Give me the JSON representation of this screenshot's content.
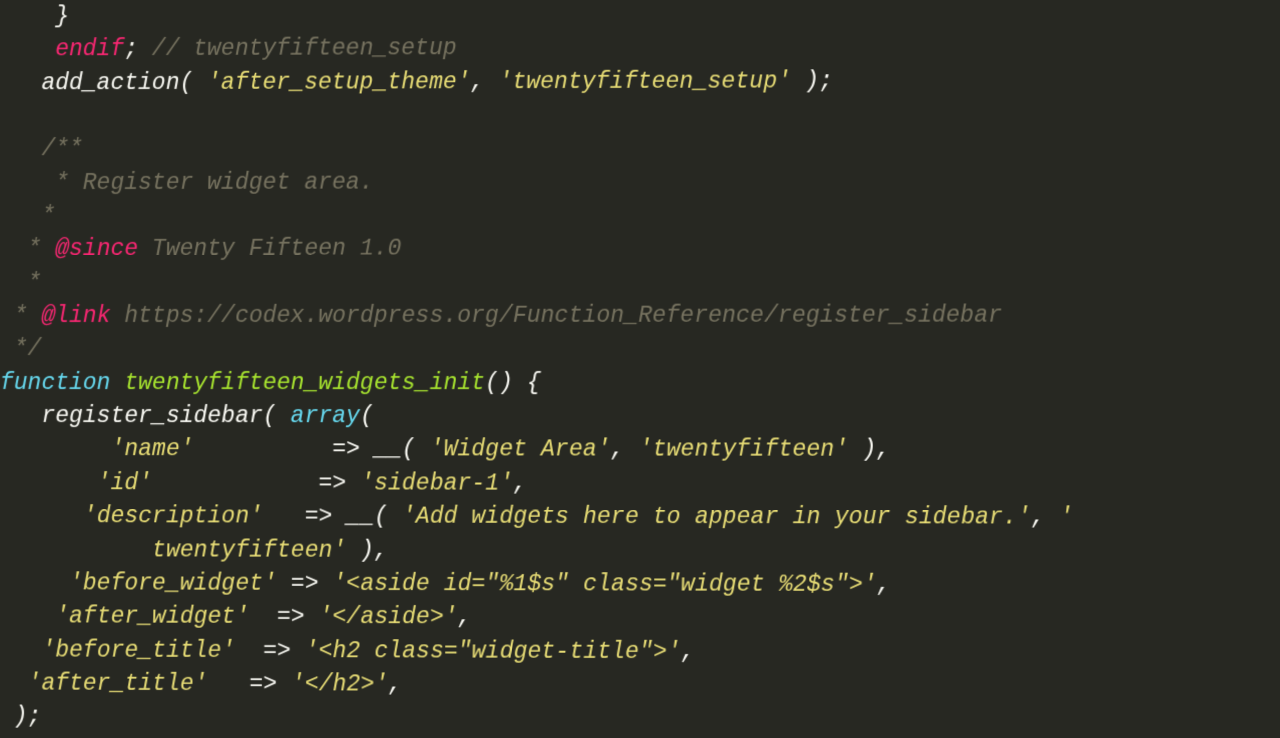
{
  "lines": {
    "l1_brace": "    }",
    "l2_endif": "    endif",
    "l2_semicolon": "; ",
    "l2_comment": "// twentyfifteen_setup",
    "l3_add_action": "   add_action( ",
    "l3_str1": "'after_setup_theme'",
    "l3_comma": ", ",
    "l3_str2": "'twentyfifteen_setup'",
    "l3_end": " );",
    "l5_c": "   /**",
    "l6_c": "    * Register widget area.",
    "l7_c": "   *",
    "l8_pre": "  * ",
    "l8_tag": "@since",
    "l8_rest": " Twenty Fifteen 1.0",
    "l9_c": "  *",
    "l10_pre": " * ",
    "l10_tag": "@link",
    "l10_rest": " https://codex.wordpress.org/Function_Reference/register_sidebar",
    "l11_c": " */",
    "l12_fn": "function",
    "l12_sp": " ",
    "l12_name": "twentyfifteen_widgets_init",
    "l12_rest": "() {",
    "l13_pre": "   register_sidebar( ",
    "l13_array": "array",
    "l13_end": "(",
    "l14_pre": "        ",
    "l14_key": "'name'",
    "l14_mid": "          => __( ",
    "l14_str1": "'Widget Area'",
    "l14_comma": ", ",
    "l14_str2": "'twentyfifteen'",
    "l14_end": " ),",
    "l15_pre": "       ",
    "l15_key": "'id'",
    "l15_mid": "            => ",
    "l15_val": "'sidebar-1'",
    "l15_end": ",",
    "l16_pre": "      ",
    "l16_key": "'description'",
    "l16_mid": "   => __( ",
    "l16_str1": "'Add widgets here to appear in your sidebar.'",
    "l16_comma": ", ",
    "l16_str2": "'",
    "l17_cont": "           twentyfifteen'",
    "l17_end": " ),",
    "l18_pre": "     ",
    "l18_key": "'before_widget'",
    "l18_mid": " => ",
    "l18_val": "'<aside id=\"%1$s\" class=\"widget %2$s\">'",
    "l18_end": ",",
    "l19_pre": "    ",
    "l19_key": "'after_widget'",
    "l19_mid": "  => ",
    "l19_val": "'</aside>'",
    "l19_end": ",",
    "l20_pre": "   ",
    "l20_key": "'before_title'",
    "l20_mid": "  => ",
    "l20_val": "'<h2 class=\"widget-title\">'",
    "l20_end": ",",
    "l21_pre": "  ",
    "l21_key": "'after_title'",
    "l21_mid": "   => ",
    "l21_val": "'</h2>'",
    "l21_end": ",",
    "l22": " );"
  }
}
